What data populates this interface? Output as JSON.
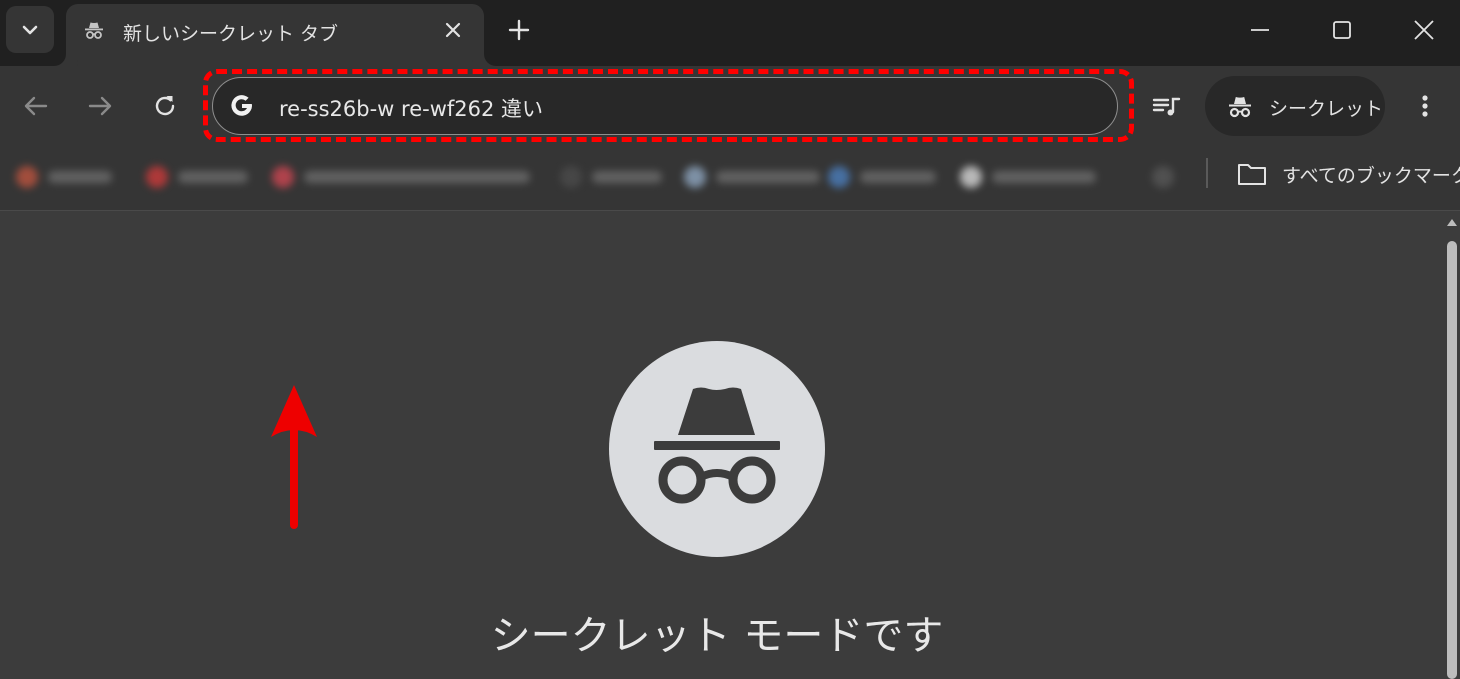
{
  "tab": {
    "title": "新しいシークレット タブ"
  },
  "omnibox": {
    "query": "re-ss26b-w re-wf262 違い"
  },
  "toolbar": {
    "incognito_label": "シークレット"
  },
  "bookmarks": {
    "all_bookmarks_label": "すべてのブックマーク"
  },
  "content": {
    "heading": "シークレット モードです"
  },
  "colors": {
    "highlight": "#ff0000",
    "arrow": "#ee0000"
  }
}
